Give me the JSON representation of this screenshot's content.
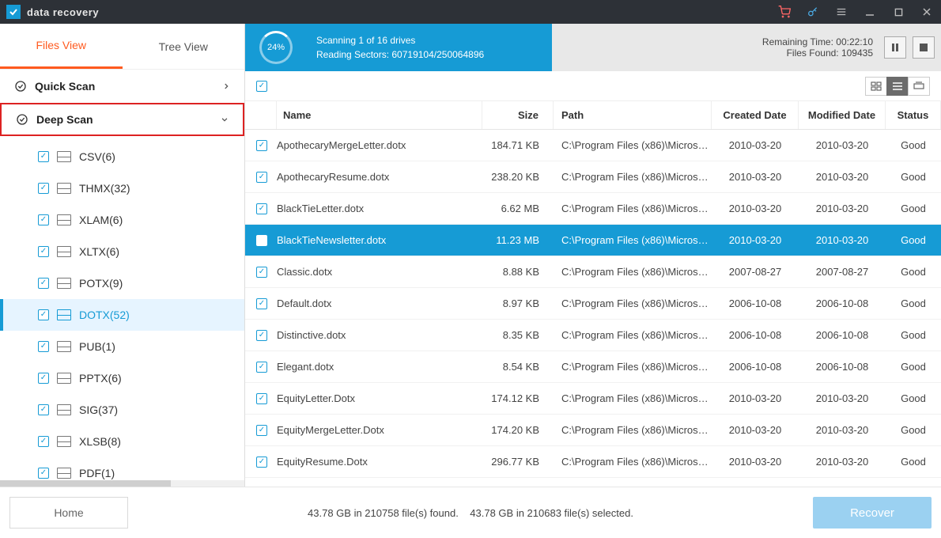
{
  "title": "data recovery",
  "tabs": {
    "files": "Files View",
    "tree": "Tree View"
  },
  "sections": {
    "quick": "Quick Scan",
    "deep": "Deep Scan"
  },
  "treeItems": [
    {
      "label": "CSV(6)"
    },
    {
      "label": "THMX(32)"
    },
    {
      "label": "XLAM(6)"
    },
    {
      "label": "XLTX(6)"
    },
    {
      "label": "POTX(9)"
    },
    {
      "label": "DOTX(52)",
      "active": true
    },
    {
      "label": "PUB(1)"
    },
    {
      "label": "PPTX(6)"
    },
    {
      "label": "SIG(37)"
    },
    {
      "label": "XLSB(8)"
    },
    {
      "label": "PDF(1)"
    }
  ],
  "progress": {
    "pct": "24%",
    "line1": "Scanning 1 of  16 drives",
    "line2": "Reading Sectors: 60719104/250064896"
  },
  "stats": {
    "remaining": "Remaining Time: 00:22:10",
    "found": "Files Found: 109435"
  },
  "columns": {
    "name": "Name",
    "size": "Size",
    "path": "Path",
    "created": "Created Date",
    "modified": "Modified Date",
    "status": "Status"
  },
  "rows": [
    {
      "name": "ApothecaryMergeLetter.dotx",
      "size": "184.71 KB",
      "path": "C:\\Program Files (x86)\\Microsoft ...",
      "created": "2010-03-20",
      "modified": "2010-03-20",
      "status": "Good"
    },
    {
      "name": "ApothecaryResume.dotx",
      "size": "238.20 KB",
      "path": "C:\\Program Files (x86)\\Microsoft ...",
      "created": "2010-03-20",
      "modified": "2010-03-20",
      "status": "Good"
    },
    {
      "name": "BlackTieLetter.dotx",
      "size": "6.62 MB",
      "path": "C:\\Program Files (x86)\\Microsoft ...",
      "created": "2010-03-20",
      "modified": "2010-03-20",
      "status": "Good"
    },
    {
      "name": "BlackTieNewsletter.dotx",
      "size": "11.23 MB",
      "path": "C:\\Program Files (x86)\\Microsoft ...",
      "created": "2010-03-20",
      "modified": "2010-03-20",
      "status": "Good",
      "selected": true
    },
    {
      "name": "Classic.dotx",
      "size": "8.88 KB",
      "path": "C:\\Program Files (x86)\\Microsoft ...",
      "created": "2007-08-27",
      "modified": "2007-08-27",
      "status": "Good"
    },
    {
      "name": "Default.dotx",
      "size": "8.97 KB",
      "path": "C:\\Program Files (x86)\\Microsoft ...",
      "created": "2006-10-08",
      "modified": "2006-10-08",
      "status": "Good"
    },
    {
      "name": "Distinctive.dotx",
      "size": "8.35 KB",
      "path": "C:\\Program Files (x86)\\Microsoft ...",
      "created": "2006-10-08",
      "modified": "2006-10-08",
      "status": "Good"
    },
    {
      "name": "Elegant.dotx",
      "size": "8.54 KB",
      "path": "C:\\Program Files (x86)\\Microsoft ...",
      "created": "2006-10-08",
      "modified": "2006-10-08",
      "status": "Good"
    },
    {
      "name": "EquityLetter.Dotx",
      "size": "174.12 KB",
      "path": "C:\\Program Files (x86)\\Microsoft ...",
      "created": "2010-03-20",
      "modified": "2010-03-20",
      "status": "Good"
    },
    {
      "name": "EquityMergeLetter.Dotx",
      "size": "174.20 KB",
      "path": "C:\\Program Files (x86)\\Microsoft ...",
      "created": "2010-03-20",
      "modified": "2010-03-20",
      "status": "Good"
    },
    {
      "name": "EquityResume.Dotx",
      "size": "296.77 KB",
      "path": "C:\\Program Files (x86)\\Microsoft ...",
      "created": "2010-03-20",
      "modified": "2010-03-20",
      "status": "Good"
    }
  ],
  "bottom": {
    "home": "Home",
    "found": "43.78 GB in 210758 file(s) found.",
    "selected": "43.78 GB in 210683 file(s) selected.",
    "recover": "Recover"
  }
}
